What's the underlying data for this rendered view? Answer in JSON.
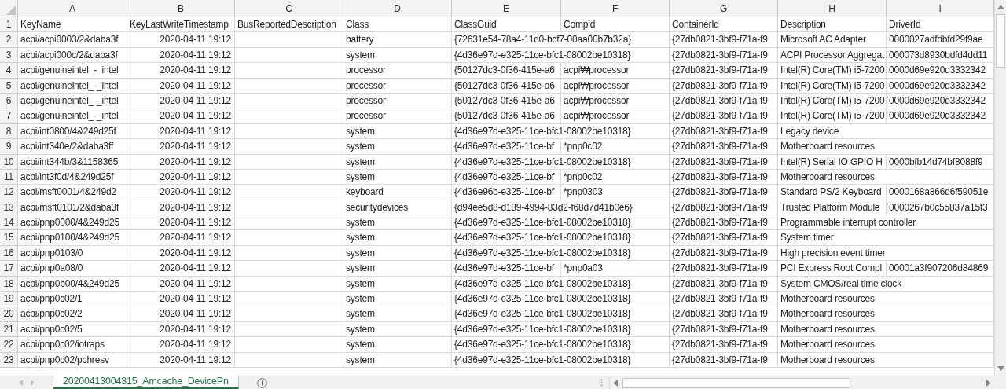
{
  "columns": [
    "A",
    "B",
    "C",
    "D",
    "E",
    "F",
    "G",
    "H",
    "I"
  ],
  "rows": [
    {
      "number": "1",
      "cells": [
        {
          "kind": "text",
          "text": "KeyName"
        },
        {
          "kind": "text",
          "text": "KeyLastWriteTimestamp"
        },
        {
          "kind": "text",
          "text": "BusReportedDescription"
        },
        {
          "kind": "text",
          "text": "Class"
        },
        {
          "kind": "text",
          "text": "ClassGuid"
        },
        {
          "kind": "text",
          "text": "Compid"
        },
        {
          "kind": "text",
          "text": "ContainerId"
        },
        {
          "kind": "text",
          "text": "Description"
        },
        {
          "kind": "text",
          "text": "DriverId"
        }
      ]
    },
    {
      "number": "2",
      "cells": [
        {
          "kind": "text",
          "text": "acpi/acpi0003/2&daba3f"
        },
        {
          "kind": "date",
          "text": "2020-04-11 19:12"
        },
        {
          "kind": "blank"
        },
        {
          "kind": "text",
          "text": "battery"
        },
        {
          "kind": "text",
          "text": "{72631e54-78a4-11d0-bcf7-00aa00b7b32a}"
        },
        {
          "kind": "blank"
        },
        {
          "kind": "text",
          "text": "{27db0821-3bf9-f71a-f9"
        },
        {
          "kind": "text",
          "text": "Microsoft AC Adapter"
        },
        {
          "kind": "text",
          "text": "0000027adfdbfd29f9ae"
        }
      ]
    },
    {
      "number": "3",
      "cells": [
        {
          "kind": "text",
          "text": "acpi/acpi000c/2&daba3f"
        },
        {
          "kind": "date",
          "text": "2020-04-11 19:12"
        },
        {
          "kind": "blank"
        },
        {
          "kind": "text",
          "text": "system"
        },
        {
          "kind": "text",
          "text": "{4d36e97d-e325-11ce-bfc1-08002be10318}"
        },
        {
          "kind": "blank"
        },
        {
          "kind": "text",
          "text": "{27db0821-3bf9-f71a-f9"
        },
        {
          "kind": "text",
          "text": "ACPI Processor Aggregat"
        },
        {
          "kind": "text",
          "text": "000073d8930bdfd4dd11"
        }
      ]
    },
    {
      "number": "4",
      "cells": [
        {
          "kind": "text",
          "text": "acpi/genuineintel_-_intel"
        },
        {
          "kind": "date",
          "text": "2020-04-11 19:12"
        },
        {
          "kind": "blank"
        },
        {
          "kind": "text",
          "text": "processor"
        },
        {
          "kind": "text",
          "text": "{50127dc3-0f36-415e-a6"
        },
        {
          "kind": "text",
          "text": "acpi₩processor"
        },
        {
          "kind": "text",
          "text": "{27db0821-3bf9-f71a-f9"
        },
        {
          "kind": "text",
          "text": "Intel(R) Core(TM) i5-7200"
        },
        {
          "kind": "text",
          "text": "0000d69e920d3332342"
        }
      ]
    },
    {
      "number": "5",
      "cells": [
        {
          "kind": "text",
          "text": "acpi/genuineintel_-_intel"
        },
        {
          "kind": "date",
          "text": "2020-04-11 19:12"
        },
        {
          "kind": "blank"
        },
        {
          "kind": "text",
          "text": "processor"
        },
        {
          "kind": "text",
          "text": "{50127dc3-0f36-415e-a6"
        },
        {
          "kind": "text",
          "text": "acpi₩processor"
        },
        {
          "kind": "text",
          "text": "{27db0821-3bf9-f71a-f9"
        },
        {
          "kind": "text",
          "text": "Intel(R) Core(TM) i5-7200"
        },
        {
          "kind": "text",
          "text": "0000d69e920d3332342"
        }
      ]
    },
    {
      "number": "6",
      "cells": [
        {
          "kind": "text",
          "text": "acpi/genuineintel_-_intel"
        },
        {
          "kind": "date",
          "text": "2020-04-11 19:12"
        },
        {
          "kind": "blank"
        },
        {
          "kind": "text",
          "text": "processor"
        },
        {
          "kind": "text",
          "text": "{50127dc3-0f36-415e-a6"
        },
        {
          "kind": "text",
          "text": "acpi₩processor"
        },
        {
          "kind": "text",
          "text": "{27db0821-3bf9-f71a-f9"
        },
        {
          "kind": "text",
          "text": "Intel(R) Core(TM) i5-7200"
        },
        {
          "kind": "text",
          "text": "0000d69e920d3332342"
        }
      ]
    },
    {
      "number": "7",
      "cells": [
        {
          "kind": "text",
          "text": "acpi/genuineintel_-_intel"
        },
        {
          "kind": "date",
          "text": "2020-04-11 19:12"
        },
        {
          "kind": "blank"
        },
        {
          "kind": "text",
          "text": "processor"
        },
        {
          "kind": "text",
          "text": "{50127dc3-0f36-415e-a6"
        },
        {
          "kind": "text",
          "text": "acpi₩processor"
        },
        {
          "kind": "text",
          "text": "{27db0821-3bf9-f71a-f9"
        },
        {
          "kind": "text",
          "text": "Intel(R) Core(TM) i5-7200"
        },
        {
          "kind": "text",
          "text": "0000d69e920d3332342"
        }
      ]
    },
    {
      "number": "8",
      "cells": [
        {
          "kind": "text",
          "text": "acpi/int0800/4&249d25f"
        },
        {
          "kind": "date",
          "text": "2020-04-11 19:12"
        },
        {
          "kind": "blank"
        },
        {
          "kind": "text",
          "text": "system"
        },
        {
          "kind": "text",
          "text": "{4d36e97d-e325-11ce-bfc1-08002be10318}"
        },
        {
          "kind": "blank"
        },
        {
          "kind": "text",
          "text": "{27db0821-3bf9-f71a-f9"
        },
        {
          "kind": "text",
          "text": "Legacy device"
        },
        {
          "kind": "blank"
        }
      ]
    },
    {
      "number": "9",
      "cells": [
        {
          "kind": "text",
          "text": "acpi/int340e/2&daba3ff"
        },
        {
          "kind": "date",
          "text": "2020-04-11 19:12"
        },
        {
          "kind": "blank"
        },
        {
          "kind": "text",
          "text": "system"
        },
        {
          "kind": "text",
          "text": "{4d36e97d-e325-11ce-bf"
        },
        {
          "kind": "text",
          "text": "*pnp0c02"
        },
        {
          "kind": "text",
          "text": "{27db0821-3bf9-f71a-f9"
        },
        {
          "kind": "text",
          "text": "Motherboard resources"
        },
        {
          "kind": "blank"
        }
      ]
    },
    {
      "number": "10",
      "cells": [
        {
          "kind": "text",
          "text": "acpi/int344b/3&1158365"
        },
        {
          "kind": "date",
          "text": "2020-04-11 19:12"
        },
        {
          "kind": "blank"
        },
        {
          "kind": "text",
          "text": "system"
        },
        {
          "kind": "text",
          "text": "{4d36e97d-e325-11ce-bfc1-08002be10318}"
        },
        {
          "kind": "blank"
        },
        {
          "kind": "text",
          "text": "{27db0821-3bf9-f71a-f9"
        },
        {
          "kind": "text",
          "text": "Intel(R) Serial IO GPIO H"
        },
        {
          "kind": "text",
          "text": "0000bfb14d74bf8088f9"
        }
      ]
    },
    {
      "number": "11",
      "cells": [
        {
          "kind": "text",
          "text": "acpi/int3f0d/4&249d25f"
        },
        {
          "kind": "date",
          "text": "2020-04-11 19:12"
        },
        {
          "kind": "blank"
        },
        {
          "kind": "text",
          "text": "system"
        },
        {
          "kind": "text",
          "text": "{4d36e97d-e325-11ce-bf"
        },
        {
          "kind": "text",
          "text": "*pnp0c02"
        },
        {
          "kind": "text",
          "text": "{27db0821-3bf9-f71a-f9"
        },
        {
          "kind": "text",
          "text": "Motherboard resources"
        },
        {
          "kind": "blank"
        }
      ]
    },
    {
      "number": "12",
      "cells": [
        {
          "kind": "text",
          "text": "acpi/msft0001/4&249d2"
        },
        {
          "kind": "date",
          "text": "2020-04-11 19:12"
        },
        {
          "kind": "blank"
        },
        {
          "kind": "text",
          "text": "keyboard"
        },
        {
          "kind": "text",
          "text": "{4d36e96b-e325-11ce-bf"
        },
        {
          "kind": "text",
          "text": "*pnp0303"
        },
        {
          "kind": "text",
          "text": "{27db0821-3bf9-f71a-f9"
        },
        {
          "kind": "text",
          "text": "Standard PS/2 Keyboard"
        },
        {
          "kind": "text",
          "text": "0000168a866d6f59051e"
        }
      ]
    },
    {
      "number": "13",
      "cells": [
        {
          "kind": "text",
          "text": "acpi/msft0101/2&daba3f"
        },
        {
          "kind": "date",
          "text": "2020-04-11 19:12"
        },
        {
          "kind": "blank"
        },
        {
          "kind": "text",
          "text": "securitydevices"
        },
        {
          "kind": "text",
          "text": "{d94ee5d8-d189-4994-83d2-f68d7d41b0e6}"
        },
        {
          "kind": "blank"
        },
        {
          "kind": "text",
          "text": "{27db0821-3bf9-f71a-f9"
        },
        {
          "kind": "text",
          "text": "Trusted Platform Module"
        },
        {
          "kind": "text",
          "text": "0000267b0c55837a15f3"
        }
      ]
    },
    {
      "number": "14",
      "cells": [
        {
          "kind": "text",
          "text": "acpi/pnp0000/4&249d25"
        },
        {
          "kind": "date",
          "text": "2020-04-11 19:12"
        },
        {
          "kind": "blank"
        },
        {
          "kind": "text",
          "text": "system"
        },
        {
          "kind": "text",
          "text": "{4d36e97d-e325-11ce-bfc1-08002be10318}"
        },
        {
          "kind": "blank"
        },
        {
          "kind": "text",
          "text": "{27db0821-3bf9-f71a-f9"
        },
        {
          "kind": "text",
          "text": "Programmable interrupt controller"
        },
        {
          "kind": "blank"
        }
      ]
    },
    {
      "number": "15",
      "cells": [
        {
          "kind": "text",
          "text": "acpi/pnp0100/4&249d25"
        },
        {
          "kind": "date",
          "text": "2020-04-11 19:12"
        },
        {
          "kind": "blank"
        },
        {
          "kind": "text",
          "text": "system"
        },
        {
          "kind": "text",
          "text": "{4d36e97d-e325-11ce-bfc1-08002be10318}"
        },
        {
          "kind": "blank"
        },
        {
          "kind": "text",
          "text": "{27db0821-3bf9-f71a-f9"
        },
        {
          "kind": "text",
          "text": "System timer"
        },
        {
          "kind": "blank"
        }
      ]
    },
    {
      "number": "16",
      "cells": [
        {
          "kind": "text",
          "text": "acpi/pnp0103/0"
        },
        {
          "kind": "date",
          "text": "2020-04-11 19:12"
        },
        {
          "kind": "blank"
        },
        {
          "kind": "text",
          "text": "system"
        },
        {
          "kind": "text",
          "text": "{4d36e97d-e325-11ce-bfc1-08002be10318}"
        },
        {
          "kind": "blank"
        },
        {
          "kind": "text",
          "text": "{27db0821-3bf9-f71a-f9"
        },
        {
          "kind": "text",
          "text": "High precision event timer"
        },
        {
          "kind": "blank"
        }
      ]
    },
    {
      "number": "17",
      "cells": [
        {
          "kind": "text",
          "text": "acpi/pnp0a08/0"
        },
        {
          "kind": "date",
          "text": "2020-04-11 19:12"
        },
        {
          "kind": "blank"
        },
        {
          "kind": "text",
          "text": "system"
        },
        {
          "kind": "text",
          "text": "{4d36e97d-e325-11ce-bf"
        },
        {
          "kind": "text",
          "text": "*pnp0a03"
        },
        {
          "kind": "text",
          "text": "{27db0821-3bf9-f71a-f9"
        },
        {
          "kind": "text",
          "text": "PCI Express Root Compl"
        },
        {
          "kind": "text",
          "text": "00001a3f907206d84869"
        }
      ]
    },
    {
      "number": "18",
      "cells": [
        {
          "kind": "text",
          "text": "acpi/pnp0b00/4&249d25"
        },
        {
          "kind": "date",
          "text": "2020-04-11 19:12"
        },
        {
          "kind": "blank"
        },
        {
          "kind": "text",
          "text": "system"
        },
        {
          "kind": "text",
          "text": "{4d36e97d-e325-11ce-bfc1-08002be10318}"
        },
        {
          "kind": "blank"
        },
        {
          "kind": "text",
          "text": "{27db0821-3bf9-f71a-f9"
        },
        {
          "kind": "text",
          "text": "System CMOS/real time clock"
        },
        {
          "kind": "blank"
        }
      ]
    },
    {
      "number": "19",
      "cells": [
        {
          "kind": "text",
          "text": "acpi/pnp0c02/1"
        },
        {
          "kind": "date",
          "text": "2020-04-11 19:12"
        },
        {
          "kind": "blank"
        },
        {
          "kind": "text",
          "text": "system"
        },
        {
          "kind": "text",
          "text": "{4d36e97d-e325-11ce-bfc1-08002be10318}"
        },
        {
          "kind": "blank"
        },
        {
          "kind": "text",
          "text": "{27db0821-3bf9-f71a-f9"
        },
        {
          "kind": "text",
          "text": "Motherboard resources"
        },
        {
          "kind": "blank"
        }
      ]
    },
    {
      "number": "20",
      "cells": [
        {
          "kind": "text",
          "text": "acpi/pnp0c02/2"
        },
        {
          "kind": "date",
          "text": "2020-04-11 19:12"
        },
        {
          "kind": "blank"
        },
        {
          "kind": "text",
          "text": "system"
        },
        {
          "kind": "text",
          "text": "{4d36e97d-e325-11ce-bfc1-08002be10318}"
        },
        {
          "kind": "blank"
        },
        {
          "kind": "text",
          "text": "{27db0821-3bf9-f71a-f9"
        },
        {
          "kind": "text",
          "text": "Motherboard resources"
        },
        {
          "kind": "blank"
        }
      ]
    },
    {
      "number": "21",
      "cells": [
        {
          "kind": "text",
          "text": "acpi/pnp0c02/5"
        },
        {
          "kind": "date",
          "text": "2020-04-11 19:12"
        },
        {
          "kind": "blank"
        },
        {
          "kind": "text",
          "text": "system"
        },
        {
          "kind": "text",
          "text": "{4d36e97d-e325-11ce-bfc1-08002be10318}"
        },
        {
          "kind": "blank"
        },
        {
          "kind": "text",
          "text": "{27db0821-3bf9-f71a-f9"
        },
        {
          "kind": "text",
          "text": "Motherboard resources"
        },
        {
          "kind": "blank"
        }
      ]
    },
    {
      "number": "22",
      "cells": [
        {
          "kind": "text",
          "text": "acpi/pnp0c02/iotraps"
        },
        {
          "kind": "date",
          "text": "2020-04-11 19:12"
        },
        {
          "kind": "blank"
        },
        {
          "kind": "text",
          "text": "system"
        },
        {
          "kind": "text",
          "text": "{4d36e97d-e325-11ce-bfc1-08002be10318}"
        },
        {
          "kind": "blank"
        },
        {
          "kind": "text",
          "text": "{27db0821-3bf9-f71a-f9"
        },
        {
          "kind": "text",
          "text": "Motherboard resources"
        },
        {
          "kind": "blank"
        }
      ]
    },
    {
      "number": "23",
      "cells": [
        {
          "kind": "text",
          "text": "acpi/pnp0c02/pchresv"
        },
        {
          "kind": "date",
          "text": "2020-04-11 19:12"
        },
        {
          "kind": "blank"
        },
        {
          "kind": "text",
          "text": "system"
        },
        {
          "kind": "text",
          "text": "{4d36e97d-e325-11ce-bfc1-08002be10318}"
        },
        {
          "kind": "blank"
        },
        {
          "kind": "text",
          "text": "{27db0821-3bf9-f71a-f9"
        },
        {
          "kind": "text",
          "text": "Motherboard resources"
        },
        {
          "kind": "blank"
        }
      ]
    }
  ],
  "sheet_tabs": [
    {
      "label": "20200413004315_Amcache_DevicePn",
      "selected": true
    }
  ]
}
